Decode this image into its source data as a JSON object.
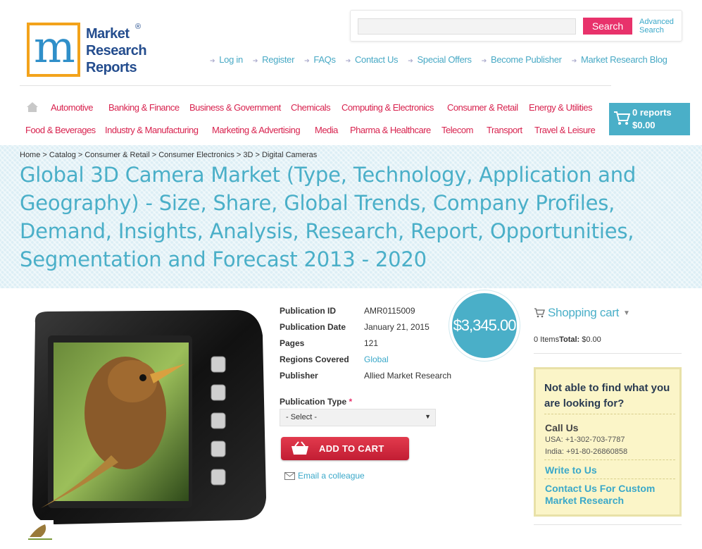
{
  "logo": {
    "line1": "Market",
    "line2": "Research",
    "line3": "Reports",
    "reg": "®",
    "mark": "m"
  },
  "search": {
    "placeholder": "",
    "button": "Search",
    "advanced_line1": "Advanced",
    "advanced_line2": "Search"
  },
  "top_links": [
    "Log in",
    "Register",
    "FAQs",
    "Contact Us",
    "Special Offers",
    "Become Publisher",
    "Market Research Blog"
  ],
  "categories_row1": [
    "Automotive",
    "Banking & Finance",
    "Business & Government",
    "Chemicals",
    "Computing & Electronics",
    "Consumer & Retail",
    "Energy & Utilities"
  ],
  "categories_row2": [
    "Food & Beverages",
    "Industry & Manufacturing",
    "Marketing & Advertising",
    "Media",
    "Pharma & Healthcare",
    "Telecom",
    "Transport",
    "Travel & Leisure"
  ],
  "mini_cart": {
    "reports": "0 reports",
    "total": "$0.00"
  },
  "breadcrumb": [
    "Home",
    "Catalog",
    "Consumer & Retail",
    "Consumer Electronics",
    "3D",
    "Digital Cameras"
  ],
  "breadcrumb_sep": " > ",
  "title": "Global 3D Camera Market (Type, Technology, Application and Geography) - Size, Share, Global Trends, Company Profiles, Demand, Insights, Analysis, Research, Report, Opportunities, Segmentation and Forecast 2013 - 2020",
  "details": {
    "pub_id_label": "Publication ID",
    "pub_id": "AMR0115009",
    "pub_date_label": "Publication Date",
    "pub_date": "January 21, 2015",
    "pages_label": "Pages",
    "pages": "121",
    "regions_label": "Regions Covered",
    "regions": "Global",
    "publisher_label": "Publisher",
    "publisher": "Allied Market Research"
  },
  "price": "$3,345.00",
  "pub_type": {
    "label": "Publication Type",
    "required": "*",
    "selected": "- Select -"
  },
  "add_to_cart": "ADD TO CART",
  "email_colleague": "Email a colleague",
  "sidebar": {
    "shopping_cart": "Shopping cart",
    "items": "0 Items",
    "total_label": "Total:",
    "total_value": " $0.00",
    "help_title": "Not able to find what you are looking for?",
    "call_us": "Call Us",
    "phone_usa": "USA: +1-302-703-7787",
    "phone_india": "India: +91-80-26860858",
    "write_to_us": "Write to Us",
    "contact_custom": "Contact Us For Custom Market Research"
  },
  "colors": {
    "brand_blue": "#4aafc8",
    "nav_pink": "#d8234f",
    "search_btn": "#e8326b",
    "cart_red": "#c21d33",
    "help_bg": "#fbf5c8"
  }
}
